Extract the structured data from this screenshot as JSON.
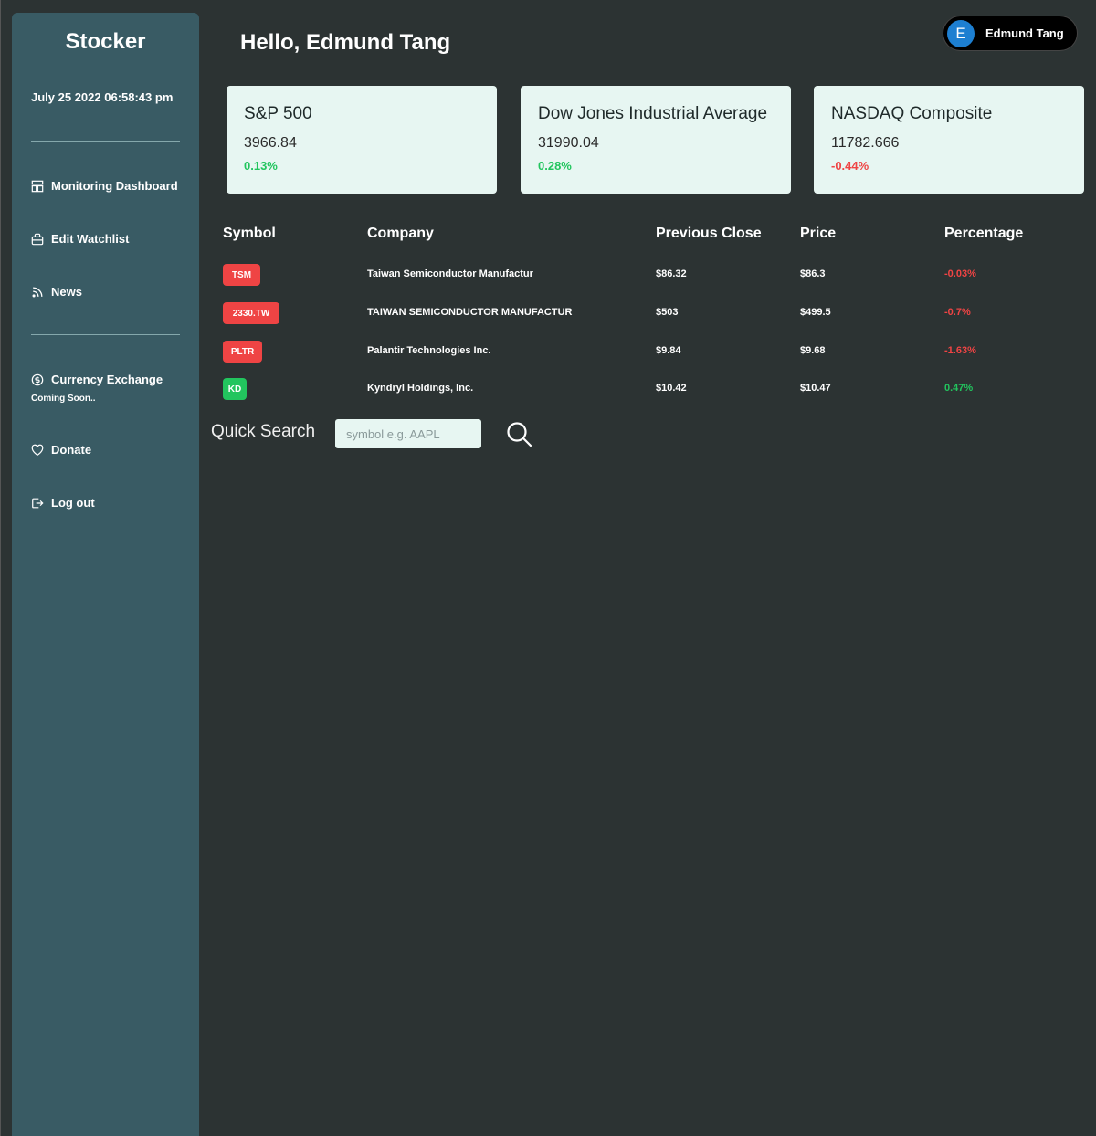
{
  "app": {
    "brand": "Stocker",
    "datetime": "July 25 2022 06:58:43 pm"
  },
  "sidebar": {
    "items": [
      {
        "label": "Monitoring Dashboard",
        "icon": "dashboard-icon"
      },
      {
        "label": "Edit Watchlist",
        "icon": "briefcase-icon"
      },
      {
        "label": "News",
        "icon": "rss-icon"
      },
      {
        "label": "Currency Exchange",
        "icon": "dollar-circle-icon",
        "note": "Coming Soon.."
      },
      {
        "label": "Donate",
        "icon": "heart-icon"
      },
      {
        "label": "Log out",
        "icon": "logout-icon"
      }
    ]
  },
  "header": {
    "greeting": "Hello, Edmund Tang"
  },
  "user": {
    "initial": "E",
    "name": "Edmund Tang"
  },
  "indices": [
    {
      "name": "S&P 500",
      "value": "3966.84",
      "change": "0.13%"
    },
    {
      "name": "Dow Jones Industrial Average",
      "value": "31990.04",
      "change": "0.28%"
    },
    {
      "name": "NASDAQ Composite",
      "value": "11782.666",
      "change": "-0.44%"
    }
  ],
  "table": {
    "headers": [
      "Symbol",
      "Company",
      "Previous Close",
      "Price",
      "Percentage"
    ],
    "rows": [
      {
        "symbol": "TSM",
        "company": "Taiwan Semiconductor Manufactur",
        "prev": "$86.32",
        "price": "$86.3",
        "pct": "-0.03%"
      },
      {
        "symbol": "2330.TW",
        "company": "TAIWAN SEMICONDUCTOR MANUFACTUR",
        "prev": "$503",
        "price": "$499.5",
        "pct": "-0.7%"
      },
      {
        "symbol": "PLTR",
        "company": "Palantir Technologies Inc.",
        "prev": "$9.84",
        "price": "$9.68",
        "pct": "-1.63%"
      },
      {
        "symbol": "KD",
        "company": "Kyndryl Holdings, Inc.",
        "prev": "$10.42",
        "price": "$10.47",
        "pct": "0.47%"
      }
    ]
  },
  "quick_search": {
    "label": "Quick Search",
    "placeholder": "symbol e.g. AAPL",
    "icon": "search-icon"
  },
  "colors": {
    "positive": "#22c55e",
    "negative": "#ef4444",
    "sidebar": "#395b64",
    "card": "#e7f6f2"
  }
}
